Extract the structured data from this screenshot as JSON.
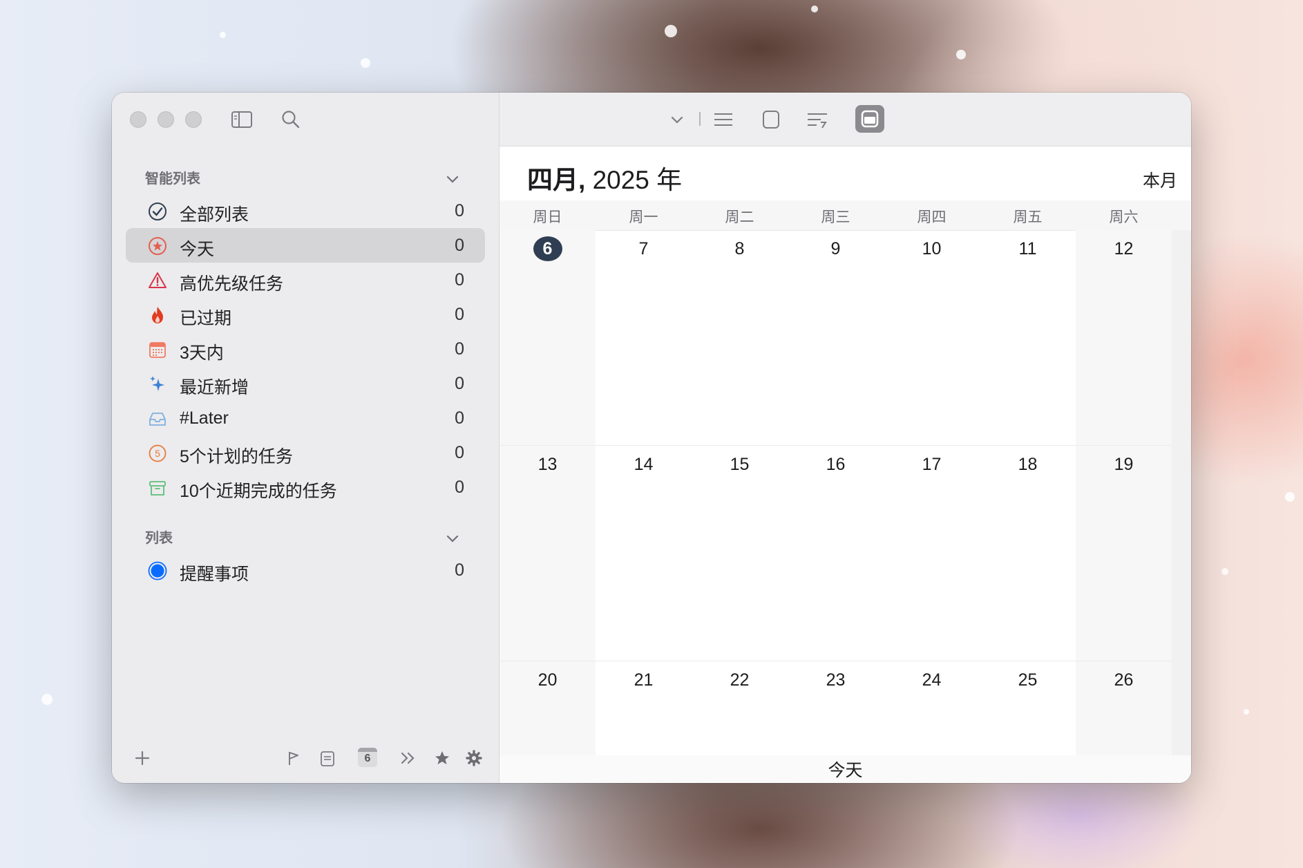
{
  "sidebar": {
    "smart_lists_header": "智能列表",
    "smart_lists": [
      {
        "icon": "checkmark-circle-icon",
        "label": "全部列表",
        "count": "0"
      },
      {
        "icon": "star-circle-icon",
        "label": "今天",
        "count": "0",
        "selected": true
      },
      {
        "icon": "warning-triangle-icon",
        "label": "高优先级任务",
        "count": "0"
      },
      {
        "icon": "flame-icon",
        "label": "已过期",
        "count": "0"
      },
      {
        "icon": "calendar-icon",
        "label": "3天内",
        "count": "0"
      },
      {
        "icon": "sparkle-icon",
        "label": "最近新增",
        "count": "0"
      },
      {
        "icon": "tray-icon",
        "label": "#Later",
        "count": "0"
      },
      {
        "icon": "number-five-circle-icon",
        "label": "5个计划的任务",
        "count": "0"
      },
      {
        "icon": "archive-box-icon",
        "label": "10个近期完成的任务",
        "count": "0"
      }
    ],
    "lists_header": "列表",
    "lists": [
      {
        "icon": "blue-dot-icon",
        "label": "提醒事项",
        "count": "0"
      }
    ],
    "bottom_calendar_badge": "6"
  },
  "calendar": {
    "month_label": "四月,",
    "year_label": "2025 年",
    "this_month_button": "本月",
    "today_button": "今天",
    "weekdays": [
      "周日",
      "周一",
      "周二",
      "周三",
      "周四",
      "周五",
      "周六"
    ],
    "weeks": [
      [
        "6",
        "7",
        "8",
        "9",
        "10",
        "11",
        "12"
      ],
      [
        "13",
        "14",
        "15",
        "16",
        "17",
        "18",
        "19"
      ],
      [
        "20",
        "21",
        "22",
        "23",
        "24",
        "25",
        "26"
      ]
    ],
    "today": "6"
  },
  "colors": {
    "today_circle": "#2f3e52",
    "selected_row": "#d5d4d7",
    "active_tool": "#8b8b8f"
  }
}
